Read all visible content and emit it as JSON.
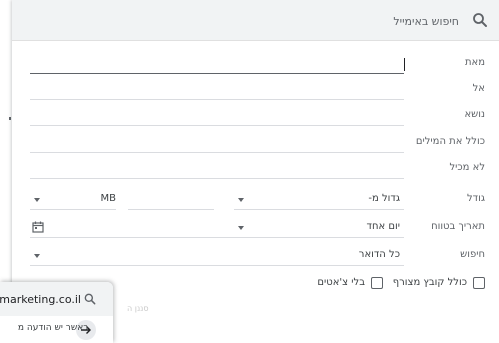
{
  "search": {
    "placeholder": "חיפוש באימייל"
  },
  "fields": {
    "from_label": "מאת",
    "to_label": "אל",
    "subject_label": "נושא",
    "has_words_label": "כולל את המילים",
    "not_has_label": "לא מכיל",
    "size_label": "גודל",
    "size_operator": "גדול מ-",
    "size_unit": "MB",
    "date_label": "תאריך בטווח",
    "date_range": "יום אחד",
    "search_in_label": "חיפוש",
    "search_in_value": "כל הדואר"
  },
  "checkboxes": {
    "has_attachment": "כולל קובץ מצורף",
    "no_chats": "בלי צ'אטים"
  },
  "popup": {
    "domain": "marketing.co.il",
    "message": "כאשר יש הודעה מ",
    "hidden_text": "סננן ה"
  },
  "icons": {
    "search": "search-icon",
    "calendar": "calendar-icon",
    "arrow": "arrow-right-icon"
  }
}
